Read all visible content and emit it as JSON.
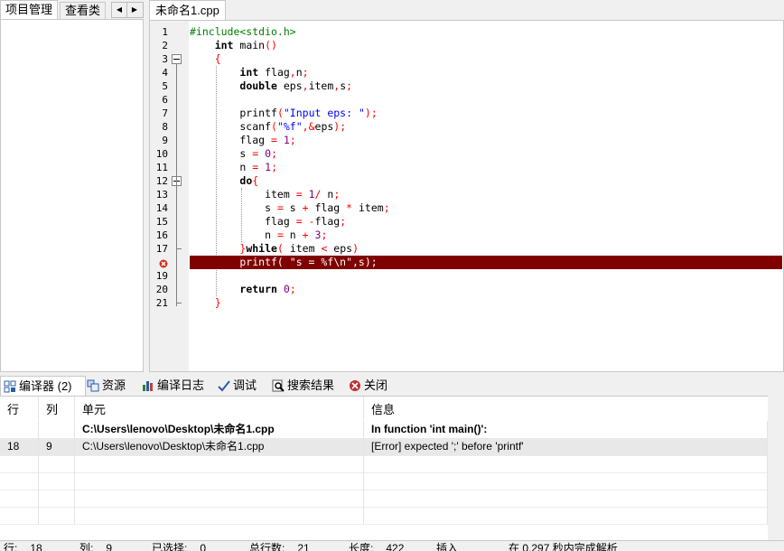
{
  "left_tabs": [
    "项目管理",
    "查看类"
  ],
  "editor_tab": "未命名1.cpp",
  "line_numbers": [
    "1",
    "2",
    "3",
    "4",
    "5",
    "6",
    "7",
    "8",
    "9",
    "10",
    "11",
    "12",
    "13",
    "14",
    "15",
    "16",
    "17",
    "18",
    "19",
    "20",
    "21"
  ],
  "error_line": 18,
  "code_lines": [
    [
      [
        "pp",
        "#include<stdio.h>"
      ]
    ],
    [
      [
        "t",
        "    "
      ],
      [
        "kw",
        "int"
      ],
      [
        "t",
        " main"
      ],
      [
        "op",
        "()"
      ]
    ],
    [
      [
        "t",
        "    "
      ],
      [
        "op",
        "{"
      ]
    ],
    [
      [
        "t",
        "        "
      ],
      [
        "kw",
        "int"
      ],
      [
        "t",
        " flag"
      ],
      [
        "op",
        ","
      ],
      [
        "t",
        "n"
      ],
      [
        "op",
        ";"
      ]
    ],
    [
      [
        "t",
        "        "
      ],
      [
        "kw",
        "double"
      ],
      [
        "t",
        " eps"
      ],
      [
        "op",
        ","
      ],
      [
        "t",
        "item"
      ],
      [
        "op",
        ","
      ],
      [
        "t",
        "s"
      ],
      [
        "op",
        ";"
      ]
    ],
    [],
    [
      [
        "t",
        "        printf"
      ],
      [
        "op",
        "("
      ],
      [
        "str",
        "\"Input eps: \""
      ],
      [
        "op",
        ");"
      ]
    ],
    [
      [
        "t",
        "        scanf"
      ],
      [
        "op",
        "("
      ],
      [
        "str",
        "\"%f\""
      ],
      [
        "op",
        ",&"
      ],
      [
        "t",
        "eps"
      ],
      [
        "op",
        ");"
      ]
    ],
    [
      [
        "t",
        "        flag "
      ],
      [
        "op",
        "="
      ],
      [
        "t",
        " "
      ],
      [
        "num",
        "1"
      ],
      [
        "op",
        ";"
      ]
    ],
    [
      [
        "t",
        "        s "
      ],
      [
        "op",
        "="
      ],
      [
        "t",
        " "
      ],
      [
        "num",
        "0"
      ],
      [
        "op",
        ";"
      ]
    ],
    [
      [
        "t",
        "        n "
      ],
      [
        "op",
        "="
      ],
      [
        "t",
        " "
      ],
      [
        "num",
        "1"
      ],
      [
        "op",
        ";"
      ]
    ],
    [
      [
        "t",
        "        "
      ],
      [
        "kw",
        "do"
      ],
      [
        "op",
        "{"
      ]
    ],
    [
      [
        "t",
        "            item "
      ],
      [
        "op",
        "="
      ],
      [
        "t",
        " "
      ],
      [
        "num",
        "1"
      ],
      [
        "op",
        "/"
      ],
      [
        "t",
        " n"
      ],
      [
        "op",
        ";"
      ]
    ],
    [
      [
        "t",
        "            s "
      ],
      [
        "op",
        "="
      ],
      [
        "t",
        " s "
      ],
      [
        "op",
        "+"
      ],
      [
        "t",
        " flag "
      ],
      [
        "op",
        "*"
      ],
      [
        "t",
        " item"
      ],
      [
        "op",
        ";"
      ]
    ],
    [
      [
        "t",
        "            flag "
      ],
      [
        "op",
        "="
      ],
      [
        "t",
        " "
      ],
      [
        "op",
        "-"
      ],
      [
        "t",
        "flag"
      ],
      [
        "op",
        ";"
      ]
    ],
    [
      [
        "t",
        "            n "
      ],
      [
        "op",
        "="
      ],
      [
        "t",
        " n "
      ],
      [
        "op",
        "+"
      ],
      [
        "t",
        " "
      ],
      [
        "num",
        "3"
      ],
      [
        "op",
        ";"
      ]
    ],
    [
      [
        "t",
        "        "
      ],
      [
        "op",
        "}"
      ],
      [
        "kw",
        "while"
      ],
      [
        "op",
        "("
      ],
      [
        "t",
        " item "
      ],
      [
        "op",
        "<"
      ],
      [
        "t",
        " eps"
      ],
      [
        "op",
        ")"
      ]
    ],
    [
      [
        "t",
        "        printf( \"s = %f\\n\",s);"
      ]
    ],
    [],
    [
      [
        "t",
        "        "
      ],
      [
        "kw",
        "return"
      ],
      [
        "t",
        " "
      ],
      [
        "num",
        "0"
      ],
      [
        "op",
        ";"
      ]
    ],
    [
      [
        "t",
        "    "
      ],
      [
        "op",
        "}"
      ]
    ]
  ],
  "bottom_tabs": [
    {
      "label": "编译器 (2)",
      "icon": "compiler-grid-icon"
    },
    {
      "label": "资源",
      "icon": "resources-icon"
    },
    {
      "label": "编译日志",
      "icon": "compile-log-chart-icon"
    },
    {
      "label": "调试",
      "icon": "debug-check-icon"
    },
    {
      "label": "搜索结果",
      "icon": "search-results-icon"
    },
    {
      "label": "关闭",
      "icon": "close-icon"
    }
  ],
  "columns": [
    "行",
    "列",
    "单元",
    "信息"
  ],
  "messages": [
    {
      "line": "",
      "col": "",
      "unit": "C:\\Users\\lenovo\\Desktop\\未命名1.cpp",
      "info": "In function 'int main()':"
    },
    {
      "line": "18",
      "col": "9",
      "unit": "C:\\Users\\lenovo\\Desktop\\未命名1.cpp",
      "info": "[Error] expected ';' before 'printf'"
    }
  ],
  "status": [
    {
      "label": "行:",
      "value": "18"
    },
    {
      "label": "列:",
      "value": "9"
    },
    {
      "label": "已选择:",
      "value": "0"
    },
    {
      "label": "总行数:",
      "value": "21"
    },
    {
      "label": "长度:",
      "value": "422"
    },
    {
      "label": "插入",
      "value": ""
    },
    {
      "label": "在 0.297 秒内完成解析",
      "value": ""
    }
  ]
}
